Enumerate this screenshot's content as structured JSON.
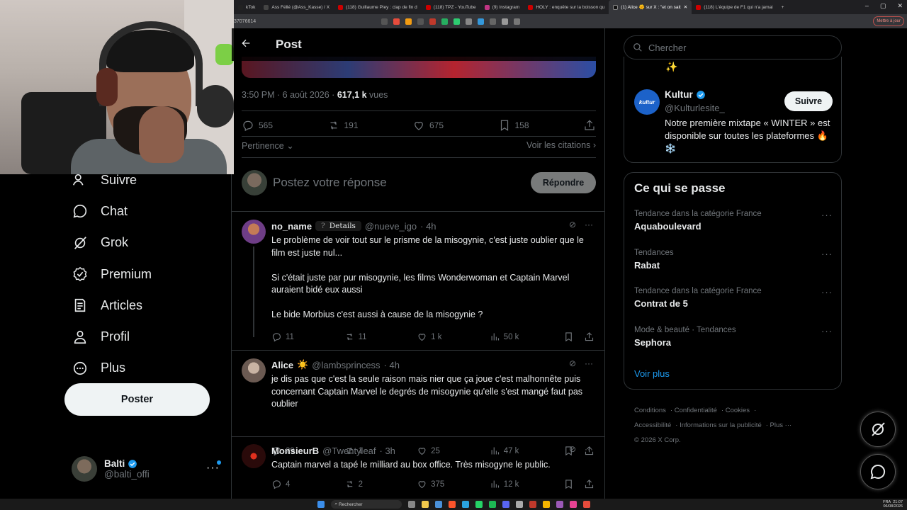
{
  "browser": {
    "tabs": [
      {
        "label": "kTok",
        "color": "#222"
      },
      {
        "label": "Ass Féllé (@Ass_Kasse) / X",
        "color": "#333"
      },
      {
        "label": "(118) Guillaume Pley : clap de fin d",
        "color": "#c00"
      },
      {
        "label": "(118) TPZ - YouTube",
        "color": "#c00"
      },
      {
        "label": "(9) Instagram",
        "color": "#c13584"
      },
      {
        "label": "HOLY : enquête sur la boisson qu",
        "color": "#c00"
      },
      {
        "label": "(1) Alice 🌞 sur X : \"et on sait",
        "color": "#111",
        "active": true
      },
      {
        "label": "(118) L'équipe de F1 qui n'a jamai",
        "color": "#c00"
      }
    ],
    "url": "37076614",
    "update_label": "Mettre à jour"
  },
  "nav": {
    "items": [
      {
        "label": "Suivre",
        "icon": "follow-icon"
      },
      {
        "label": "Chat",
        "icon": "chat-icon"
      },
      {
        "label": "Grok",
        "icon": "grok-icon"
      },
      {
        "label": "Premium",
        "icon": "premium-icon"
      },
      {
        "label": "Articles",
        "icon": "articles-icon"
      },
      {
        "label": "Profil",
        "icon": "profile-icon"
      },
      {
        "label": "Plus",
        "icon": "more-icon"
      }
    ],
    "post_label": "Poster",
    "account_name": "Balti",
    "account_handle": "@balti_offi"
  },
  "main": {
    "title": "Post",
    "meta_time": "3:50 PM · 6 août 2026 · ",
    "meta_views_count": "617,1 k",
    "meta_views_label": " vues",
    "stats": {
      "replies": "565",
      "reposts": "191",
      "likes": "675",
      "bookmarks": "158"
    },
    "sort_label": "Pertinence",
    "quotes_label": "Voir les citations",
    "reply_placeholder": "Postez votre réponse",
    "reply_button": "Répondre"
  },
  "tweets": [
    {
      "name": "no_name",
      "chip": "Details",
      "handle": "@nueve_igo",
      "time": "· 4h",
      "text": "Le problème de voir tout sur le prisme de la misogynie, c'est juste oublier que le film est juste nul...\n\nSi c'était juste par pur misogynie, les films Wonderwoman et Captain Marvel auraient bidé eux aussi\n\nLe bide Morbius c'est aussi à cause de la misogynie ?",
      "replies": "11",
      "reposts": "11",
      "likes": "1 k",
      "views": "50 k",
      "avatar_color": "#7a3f8c"
    },
    {
      "name": "Alice",
      "emoji": "☀️",
      "handle": "@lambsprincess",
      "time": "· 4h",
      "text": "je dis pas que c'est la seule raison mais nier que ça joue c'est malhonnête puis concernant Captain Marvel le degrés de misogynie qu'elle s'est mangé faut pas oublier",
      "replies": "29",
      "reposts": "1",
      "likes": "25",
      "views": "47 k",
      "avatar_color": "#8e7a6e"
    },
    {
      "name": "MonsieurB",
      "handle": "@Twentyleaf",
      "time": "· 3h",
      "text": "Captain marvel a tapé le milliard au box office. Très misogyne le public.",
      "replies": "4",
      "reposts": "2",
      "likes": "375",
      "views": "12 k",
      "avatar_color": "#3a0f0f"
    }
  ],
  "right": {
    "search_placeholder": "Chercher",
    "promo": {
      "logo_text": "kultur",
      "name": "Kultur",
      "handle": "@Kulturlesite_",
      "follow_label": "Suivre",
      "text": "Notre première mixtape « WINTER » est disponible sur toutes les plateformes 🔥❄️"
    },
    "trends_title": "Ce qui se passe",
    "trends": [
      {
        "category": "Tendance dans la catégorie France",
        "name": "Aquaboulevard"
      },
      {
        "category": "Tendances",
        "name": "Rabat"
      },
      {
        "category": "Tendance dans la catégorie France",
        "name": "Contrat de 5"
      },
      {
        "category": "Mode & beauté · Tendances",
        "name": "Sephora"
      }
    ],
    "see_more": "Voir plus",
    "footer": {
      "l1": [
        "Conditions",
        "Confidentialité",
        "Cookies"
      ],
      "l2": [
        "Accessibilité",
        "Informations sur la publicité",
        "Plus ···"
      ],
      "copyright": "© 2026 X Corp."
    }
  },
  "taskbar": {
    "search_label": "Rechercher",
    "lang": "FRA",
    "time": "21:07",
    "date": "06/08/2026"
  },
  "colors": {
    "accent": "#1d9bf0",
    "background": "#000000",
    "border": "#2f3336",
    "muted": "#71767b"
  }
}
